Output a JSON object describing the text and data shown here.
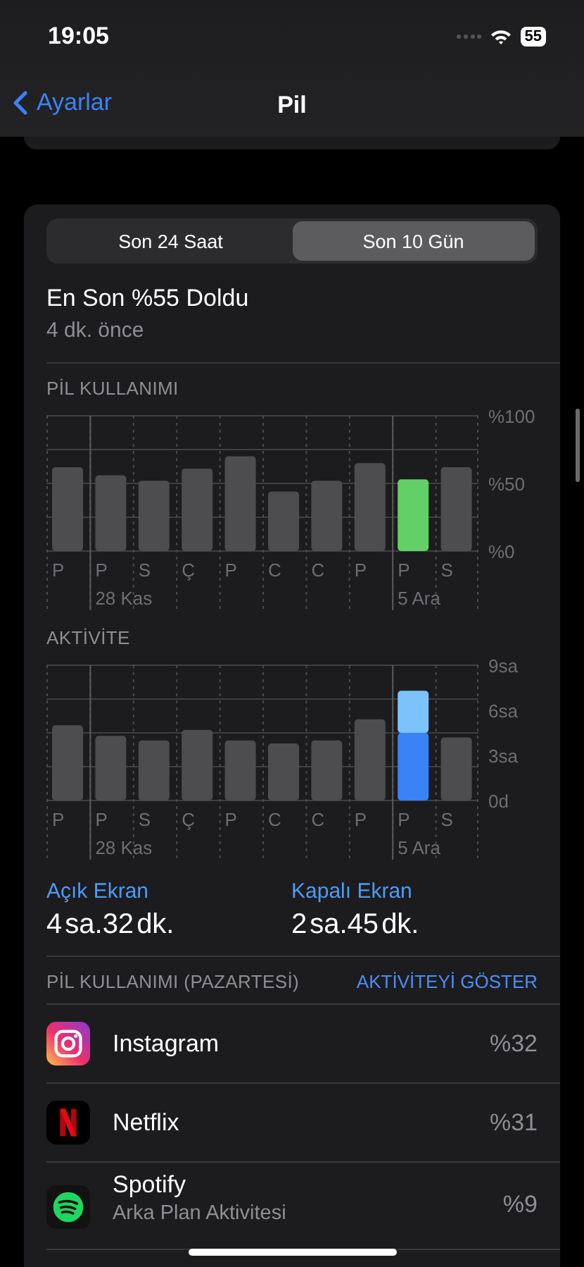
{
  "status_bar": {
    "time": "19:05",
    "battery": "55"
  },
  "nav": {
    "back": "Ayarlar",
    "title": "Pil"
  },
  "tabs": [
    {
      "label": "Son 24 Saat",
      "selected": false
    },
    {
      "label": "Son 10 Gün",
      "selected": true
    }
  ],
  "last_charge": {
    "title": "En Son %55 Doldu",
    "subtitle": "4 dk. önce"
  },
  "charts": [
    {
      "title": "PİL KULLANIMI",
      "chart_data": {
        "type": "bar",
        "stacked": true,
        "categories": [
          "P",
          "P\n28 Kas",
          "S",
          "Ç",
          "P",
          "C",
          "C",
          "P",
          "P\n5 Ara",
          "S"
        ],
        "ylim": [
          0,
          100
        ],
        "yticks": [
          {
            "value": 0,
            "label": "%0"
          },
          {
            "value": 50,
            "label": "%50"
          },
          {
            "value": 100,
            "label": "%100"
          }
        ],
        "series": [
          {
            "color": "#4d4d4f",
            "values": [
              62,
              56,
              52,
              61,
              70,
              44,
              52,
              65,
              null,
              62
            ]
          },
          {
            "color": "#63cf67",
            "values": [
              null,
              null,
              null,
              null,
              null,
              null,
              null,
              null,
              53,
              null
            ]
          }
        ]
      }
    },
    {
      "title": "AKTİVİTE",
      "chart_data": {
        "type": "bar",
        "stacked": true,
        "categories": [
          "P",
          "P\n28 Kas",
          "S",
          "Ç",
          "P",
          "C",
          "C",
          "P",
          "P\n5 Ara",
          "S"
        ],
        "ylim": [
          0,
          9
        ],
        "yticks": [
          {
            "value": 0,
            "label": "0d"
          },
          {
            "value": 3,
            "label": "3sa"
          },
          {
            "value": 6,
            "label": "6sa"
          },
          {
            "value": 9,
            "label": "9sa"
          }
        ],
        "series": [
          {
            "color": "#4d4d4f",
            "values": [
              5.0,
              4.3,
              4.0,
              4.7,
              4.0,
              3.8,
              4.0,
              5.4,
              null,
              4.2
            ]
          },
          {
            "color": "#3a82f6",
            "values": [
              null,
              null,
              null,
              null,
              null,
              null,
              null,
              null,
              4.5,
              null
            ]
          },
          {
            "color": "#7cc3fb",
            "values": [
              null,
              null,
              null,
              null,
              null,
              null,
              null,
              null,
              2.8,
              null
            ]
          }
        ]
      }
    }
  ],
  "screen_time": [
    {
      "label": "Açık Ekran",
      "hours": "4",
      "hours_unit": "sa.",
      "minutes": "32",
      "minutes_unit": "dk."
    },
    {
      "label": "Kapalı Ekran",
      "hours": "2",
      "hours_unit": "sa.",
      "minutes": "45",
      "minutes_unit": "dk."
    }
  ],
  "usage": {
    "title": "PİL KULLANIMI (PAZARTESİ)",
    "link": "AKTİVİTEYİ GÖSTER",
    "apps": [
      {
        "kind": "camera",
        "name": "Instagram",
        "value": "%32"
      },
      {
        "kind": "letter",
        "name": "Netflix",
        "value": "%31"
      },
      {
        "kind": "waves",
        "name": "Spotify",
        "detail": "Arka Plan Aktivitesi",
        "value": "%9"
      }
    ]
  }
}
